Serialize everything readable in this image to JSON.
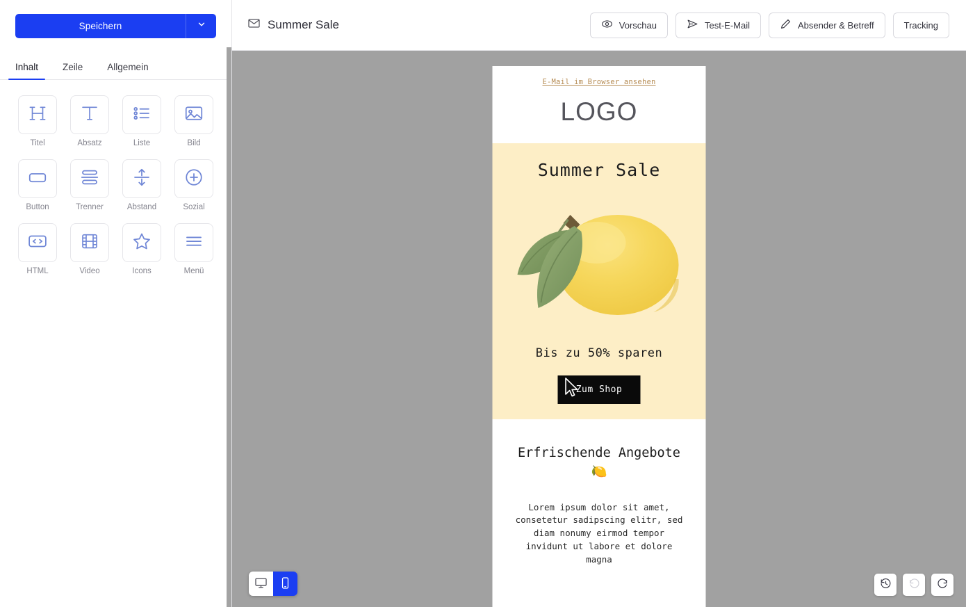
{
  "sidebar": {
    "save_label": "Speichern",
    "save_caret_icon": "chevron-down-icon",
    "tabs": [
      {
        "label": "Inhalt",
        "active": true
      },
      {
        "label": "Zeile",
        "active": false
      },
      {
        "label": "Allgemein",
        "active": false
      }
    ],
    "blocks": [
      {
        "label": "Titel",
        "icon": "heading-icon"
      },
      {
        "label": "Absatz",
        "icon": "text-icon"
      },
      {
        "label": "Liste",
        "icon": "list-icon"
      },
      {
        "label": "Bild",
        "icon": "image-icon"
      },
      {
        "label": "Button",
        "icon": "button-icon"
      },
      {
        "label": "Trenner",
        "icon": "divider-icon"
      },
      {
        "label": "Abstand",
        "icon": "spacer-icon"
      },
      {
        "label": "Sozial",
        "icon": "social-plus-icon"
      },
      {
        "label": "HTML",
        "icon": "code-icon"
      },
      {
        "label": "Video",
        "icon": "video-icon"
      },
      {
        "label": "Icons",
        "icon": "star-icon"
      },
      {
        "label": "Menü",
        "icon": "menu-icon"
      }
    ]
  },
  "topbar": {
    "mail_icon": "envelope-icon",
    "title": "Summer Sale",
    "actions": [
      {
        "label": "Vorschau",
        "icon": "eye-icon"
      },
      {
        "label": "Test-E-Mail",
        "icon": "paper-plane-icon"
      },
      {
        "label": "Absender & Betreff",
        "icon": "pencil-icon"
      },
      {
        "label": "Tracking",
        "icon": "none"
      }
    ]
  },
  "email": {
    "browser_link": "E-Mail im Browser ansehen",
    "logo": "LOGO",
    "hero_title": "Summer Sale",
    "hero_image": "lemon-illustration",
    "hero_subtitle": "Bis zu 50% sparen",
    "cta_label": "Zum Shop",
    "body_title": "Erfrischende Angebote 🍋",
    "body_text": "Lorem ipsum dolor sit amet, consetetur sadipscing elitr, sed diam nonumy eirmod tempor invidunt ut labore et dolore magna"
  },
  "controls": {
    "device_desktop_icon": "desktop-icon",
    "device_mobile_icon": "mobile-icon",
    "device_active": "mobile",
    "history_icon": "history-clock-icon",
    "undo_icon": "undo-icon",
    "redo_icon": "redo-icon"
  },
  "colors": {
    "brand_blue": "#1b3ef2",
    "canvas_gray": "#a1a1a1",
    "hero_cream": "#fdeec6",
    "link_tan": "#b68c54",
    "cta_black": "#0a0a0a"
  }
}
